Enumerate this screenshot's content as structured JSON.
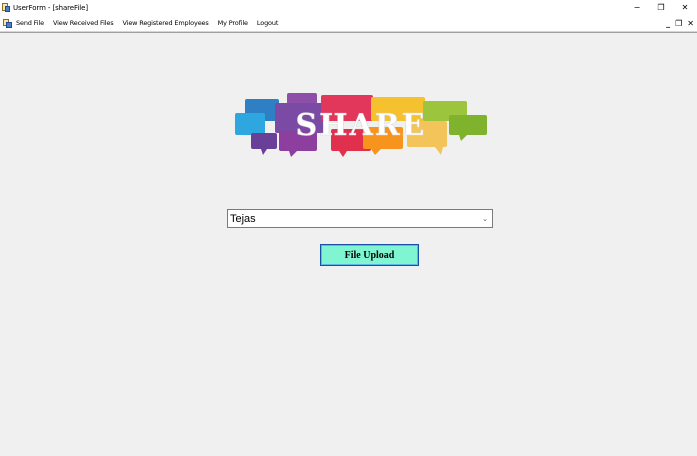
{
  "window": {
    "title": "UserForm - [shareFile]",
    "controls": {
      "minimize": "−",
      "restore": "❐",
      "close": "✕"
    }
  },
  "menu": {
    "items": [
      {
        "label": "Send File"
      },
      {
        "label": "View Received Files"
      },
      {
        "label": "View Registered Employees"
      },
      {
        "label": "My Profile"
      },
      {
        "label": "Logout"
      }
    ],
    "mdi_controls": {
      "minimize": "_",
      "restore": "❐",
      "close": "✕"
    }
  },
  "logo": {
    "text": "SHARE"
  },
  "employee_select": {
    "value": "Tejas"
  },
  "upload_button": {
    "label": "File Upload",
    "color": "#7ff5d2"
  },
  "colors": {
    "background": "#f0f0f0",
    "titlebar": "#ffffff"
  },
  "icons": {
    "app": "app-icon",
    "dropdown": "chevron-down-icon"
  }
}
